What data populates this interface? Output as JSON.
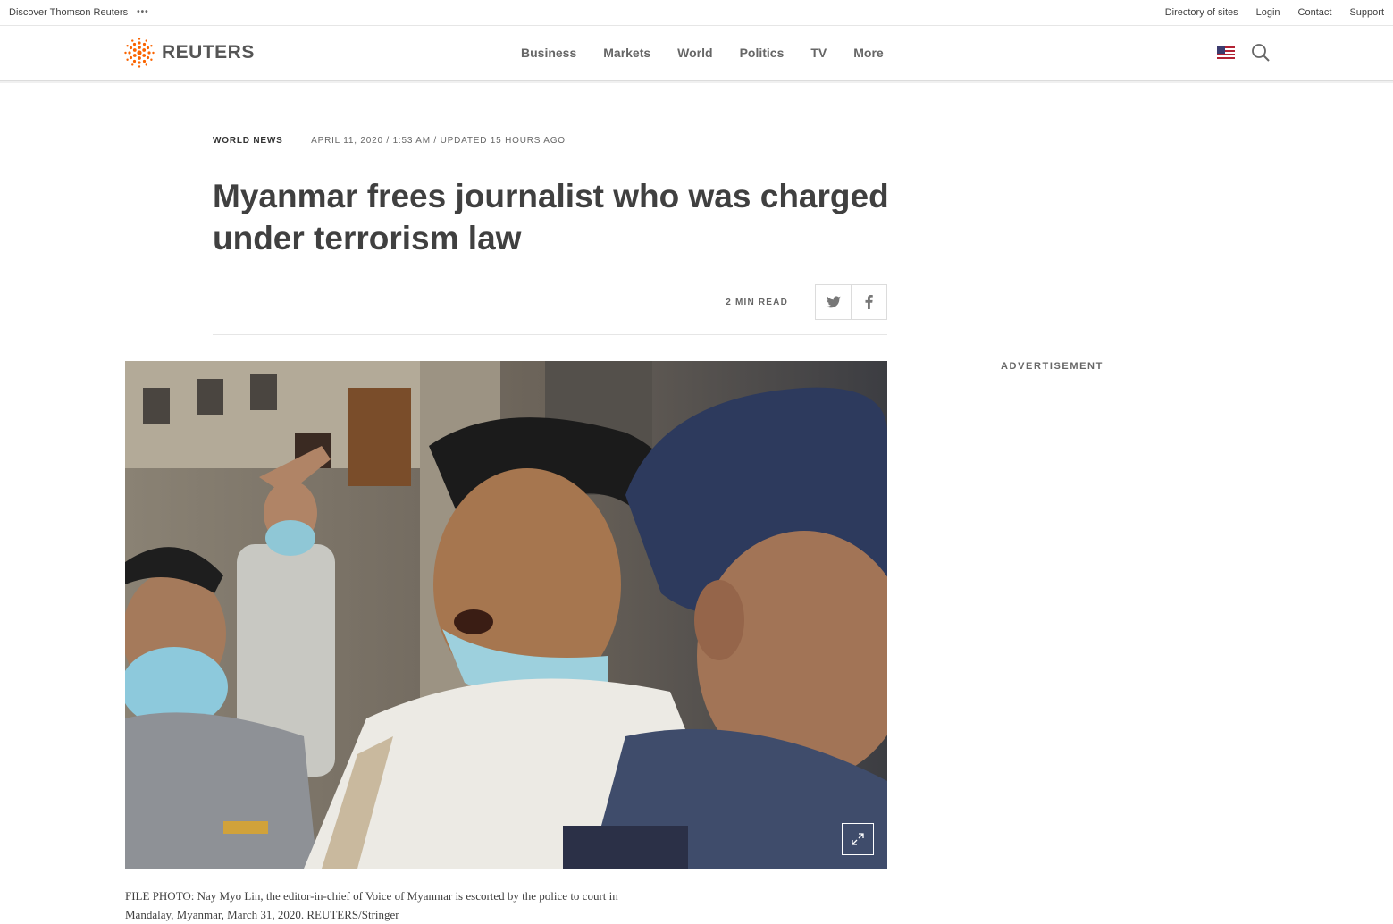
{
  "topbar": {
    "brand_link": "Discover Thomson Reuters",
    "more_icon": "more-dots-icon",
    "links": [
      "Directory of sites",
      "Login",
      "Contact",
      "Support"
    ]
  },
  "header": {
    "logo_text": "REUTERS",
    "logo_icon": "reuters-dots-logo",
    "nav": [
      "Business",
      "Markets",
      "World",
      "Politics",
      "TV",
      "More"
    ],
    "edition_flag_icon": "us-flag-icon",
    "search_icon": "search-icon"
  },
  "article": {
    "section": "World News",
    "timestamp": "April 11, 2020 / 1:53 AM / Updated 15 hours ago",
    "headline": "Myanmar frees journalist who was charged under terrorism law",
    "read_time": "2 Min Read",
    "share": [
      {
        "icon": "twitter-icon"
      },
      {
        "icon": "facebook-icon"
      }
    ],
    "photo_caption": "FILE PHOTO: Nay Myo Lin, the editor-in-chief of Voice of Myanmar is escorted by the police to court in Mandalay, Myanmar, March 31, 2020. REUTERS/Stringer",
    "expand_icon": "expand-icon"
  },
  "sidebar": {
    "ad_label": "Advertisement"
  },
  "colors": {
    "accent_orange": "#fa6400",
    "text": "#404040",
    "muted": "#666666",
    "border": "#e6e6e6"
  }
}
